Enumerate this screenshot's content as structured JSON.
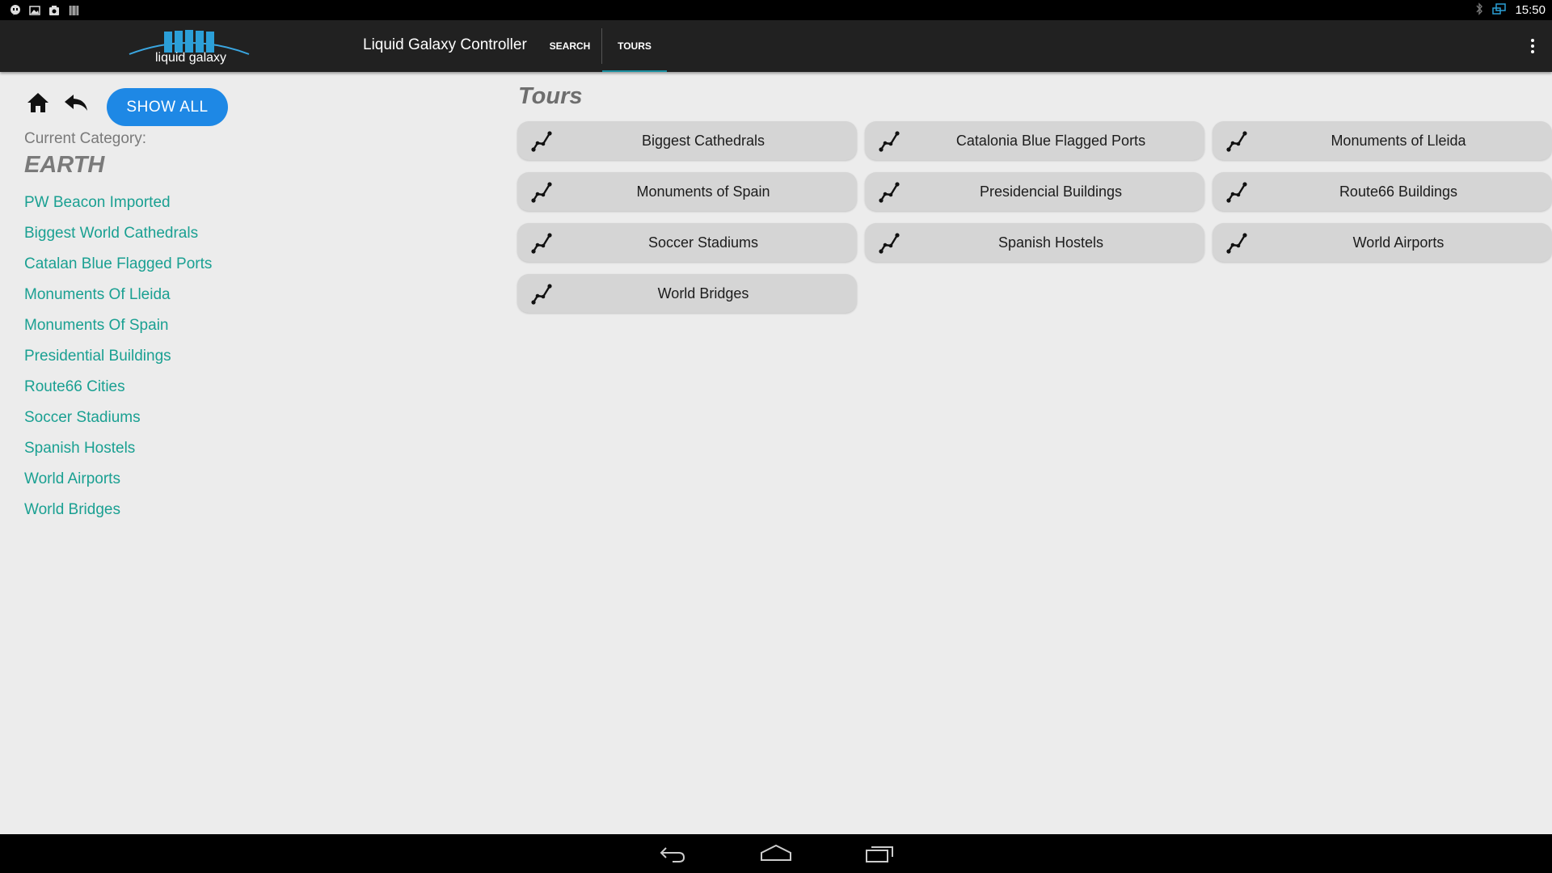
{
  "status_bar": {
    "left_icons": [
      "hangouts-icon",
      "image-icon",
      "photo-icon",
      "barcode-icon"
    ],
    "right_icons": [
      "bluetooth-icon",
      "screen-cast-icon"
    ],
    "time": "15:50"
  },
  "app_bar": {
    "logo_text": "liquid galaxy",
    "title": "Liquid Galaxy Controller",
    "tabs": [
      {
        "label": "SEARCH",
        "active": false
      },
      {
        "label": "TOURS",
        "active": true
      }
    ],
    "menu_icon": "overflow-menu-icon"
  },
  "sidebar": {
    "home_icon": "home-icon",
    "back_icon": "reply-back-icon",
    "show_all_label": "SHOW ALL",
    "current_category_label": "Current Category:",
    "current_category": "EARTH",
    "categories": [
      "PW Beacon Imported",
      "Biggest World Cathedrals",
      "Catalan Blue Flagged Ports",
      "Monuments Of Lleida",
      "Monuments Of Spain",
      "Presidential Buildings",
      "Route66 Cities",
      "Soccer Stadiums",
      "Spanish Hostels",
      "World Airports",
      "World Bridges"
    ]
  },
  "tours": {
    "title": "Tours",
    "icon": "route-path-icon",
    "items": [
      "Biggest Cathedrals",
      "Catalonia Blue Flagged Ports",
      "Monuments of Lleida",
      "Monuments of Spain",
      "Presidencial Buildings",
      "Route66 Buildings",
      "Soccer Stadiums",
      "Spanish Hostels",
      "World Airports",
      "World Bridges"
    ]
  },
  "nav_bar": {
    "icons": [
      "back-nav-icon",
      "home-nav-icon",
      "recent-apps-icon"
    ]
  },
  "colors": {
    "accent_link": "#1aa092",
    "button_blue": "#1e88e5",
    "app_bar": "#212121",
    "tab_indicator": "#1a8fa0"
  }
}
